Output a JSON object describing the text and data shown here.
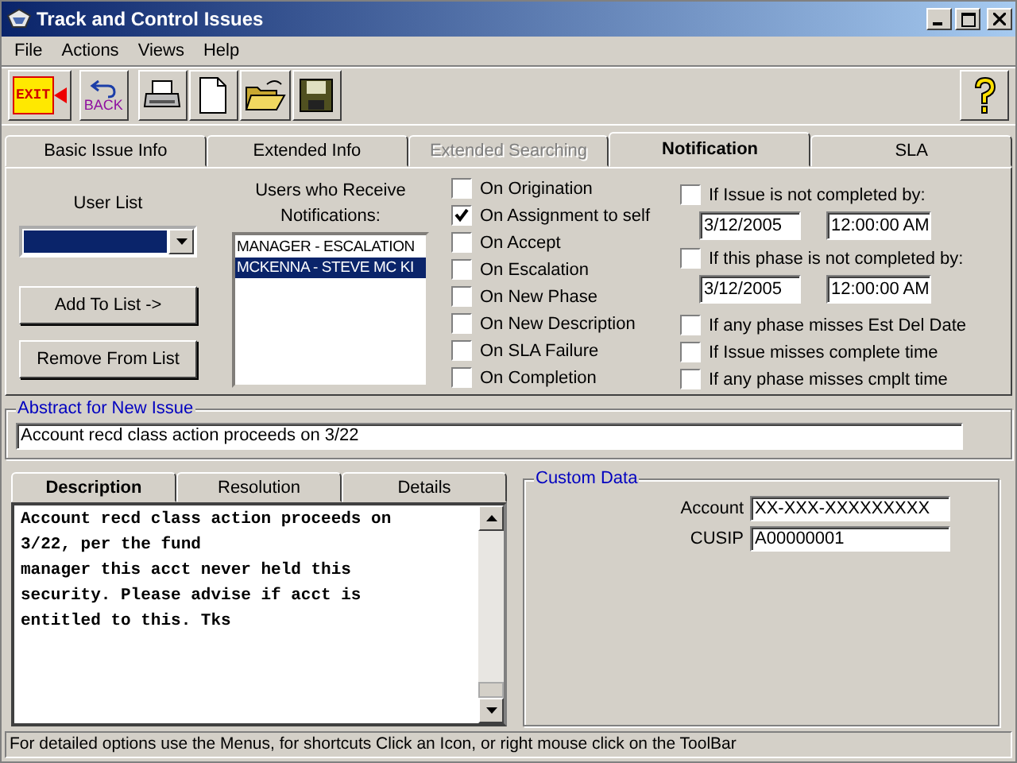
{
  "window": {
    "title": "Track and Control Issues"
  },
  "menu": [
    "File",
    "Actions",
    "Views",
    "Help"
  ],
  "toolbar": {
    "exit_label": "EXIT",
    "back_label": "BACK"
  },
  "tabs": [
    {
      "label": "Basic Issue Info",
      "selected": false,
      "disabled": false
    },
    {
      "label": "Extended Info",
      "selected": false,
      "disabled": false
    },
    {
      "label": "Extended Searching",
      "selected": false,
      "disabled": true
    },
    {
      "label": "Notification",
      "selected": true,
      "disabled": false
    },
    {
      "label": "SLA",
      "selected": false,
      "disabled": false
    }
  ],
  "user_list": {
    "label": "User List",
    "add_button": "Add To List ->",
    "remove_button": "Remove From List"
  },
  "recipients": {
    "label": "Users who Receive Notifications:",
    "items": [
      {
        "text": "MANAGER - ESCALATION",
        "selected": false
      },
      {
        "text": "MCKENNA - STEVE MC KI",
        "selected": true
      }
    ]
  },
  "events": [
    {
      "label": "On Origination",
      "checked": false
    },
    {
      "label": "On Assignment to self",
      "checked": true
    },
    {
      "label": "On Accept",
      "checked": false
    },
    {
      "label": "On Escalation",
      "checked": false
    },
    {
      "label": "On New Phase",
      "checked": false
    },
    {
      "label": "On New Description",
      "checked": false
    },
    {
      "label": "On SLA Failure",
      "checked": false
    },
    {
      "label": "On Completion",
      "checked": false
    }
  ],
  "deadlines": [
    {
      "label": "If Issue is not completed by:",
      "checked": false,
      "date": "3/12/2005",
      "time": "12:00:00 AM"
    },
    {
      "label": "If this phase is not completed by:",
      "checked": false,
      "date": "3/12/2005",
      "time": "12:00:00 AM"
    }
  ],
  "misses": [
    {
      "label": "If any phase misses Est Del Date",
      "checked": false
    },
    {
      "label": "If Issue misses complete time",
      "checked": false
    },
    {
      "label": "If any phase misses cmplt time",
      "checked": false
    }
  ],
  "abstract": {
    "legend": "Abstract for New Issue",
    "value": "Account recd class action proceeds on 3/22"
  },
  "detail_tabs": [
    {
      "label": "Description",
      "selected": true
    },
    {
      "label": "Resolution",
      "selected": false
    },
    {
      "label": "Details",
      "selected": false
    }
  ],
  "description_lines": [
    "Account recd class action proceeds on",
    "3/22, per the fund",
    "manager this acct never held this",
    "security.  Please advise if acct is",
    "entitled to this.  Tks"
  ],
  "custom_data": {
    "legend": "Custom Data",
    "fields": [
      {
        "label": "Account",
        "value": "XX-XXX-XXXXXXXXX"
      },
      {
        "label": "CUSIP",
        "value": "A00000001"
      }
    ]
  },
  "status_bar": "For detailed options use the Menus, for shortcuts Click an Icon, or right mouse click on the ToolBar"
}
